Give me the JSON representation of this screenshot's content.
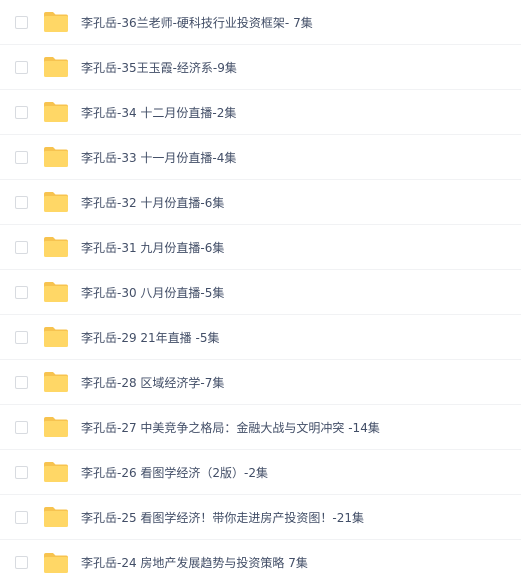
{
  "files": [
    {
      "name": "李孔岳-36兰老师-硬科技行业投资框架- 7集"
    },
    {
      "name": "李孔岳-35王玉霞-经济系-9集"
    },
    {
      "name": "李孔岳-34 十二月份直播-2集"
    },
    {
      "name": "李孔岳-33 十一月份直播-4集"
    },
    {
      "name": "李孔岳-32 十月份直播-6集"
    },
    {
      "name": "李孔岳-31 九月份直播-6集"
    },
    {
      "name": "李孔岳-30 八月份直播-5集"
    },
    {
      "name": "李孔岳-29 21年直播 -5集"
    },
    {
      "name": "李孔岳-28 区域经济学-7集"
    },
    {
      "name": "李孔岳-27 中美竞争之格局：金融大战与文明冲突 -14集"
    },
    {
      "name": "李孔岳-26 看图学经济（2版）-2集"
    },
    {
      "name": "李孔岳-25 看图学经济！带你走进房产投资图！-21集"
    },
    {
      "name": "李孔岳-24 房地产发展趋势与投资策略 7集"
    }
  ],
  "icons": {
    "folder": "folder-icon",
    "checkbox": "checkbox"
  },
  "colors": {
    "folder_body": "#ffd766",
    "folder_tab": "#f7c34f",
    "text": "#424e67",
    "checkbox_border": "#d8dbe0",
    "row_divider": "#f1f2f4"
  }
}
